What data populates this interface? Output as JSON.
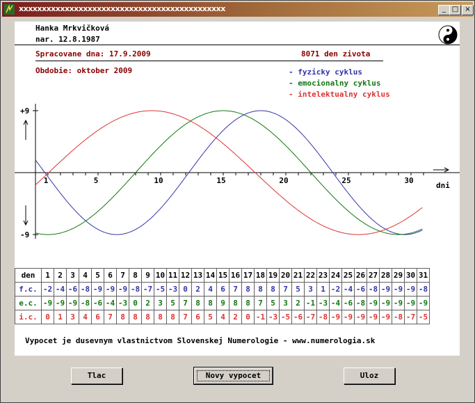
{
  "window": {
    "title": "xxxxxxxxxxxxxxxxxxxxxxxxxxxxxxxxxxxxxxxxxxxxx",
    "controls": {
      "minimize": "_",
      "maximize": "□",
      "close": "×"
    }
  },
  "header": {
    "name": "Hanka Mrkvičková",
    "birth": "nar. 12.8.1987",
    "processed": "Spracovane dna: 17.9.2009",
    "days_alive": "8071 den zivota",
    "period": "Obdobie: oktober 2009"
  },
  "colors": {
    "physical": "#3333aa",
    "emotional": "#117711",
    "intellectual": "#dd3333",
    "header_red": "#880000"
  },
  "chart_data": {
    "type": "line",
    "legend": [
      {
        "label": "- fyzicky cyklus",
        "color": "#3333aa"
      },
      {
        "label": "- emocionalny cyklus",
        "color": "#117711"
      },
      {
        "label": "- intelektualny cyklus",
        "color": "#dd3333"
      }
    ],
    "y_top_label": "+9",
    "y_bottom_label": "-9",
    "x_label": "dni",
    "x_ticks": [
      1,
      5,
      10,
      15,
      20,
      25,
      30
    ],
    "ylim": [
      -9,
      9
    ],
    "xlim": [
      1,
      31
    ],
    "series": [
      {
        "name": "fyzicky cyklus",
        "period": 23,
        "peak_day": 18,
        "color": "#3333aa"
      },
      {
        "name": "emocionalny cyklus",
        "period": 28,
        "peak_day": 15,
        "color": "#117711"
      },
      {
        "name": "intelektualny cyklus",
        "period": 33,
        "peak_day": 9.3,
        "color": "#dd3333"
      }
    ]
  },
  "table": {
    "header_label": "den",
    "days": [
      "1",
      "2",
      "3",
      "4",
      "5",
      "6",
      "7",
      "8",
      "9",
      "10",
      "11",
      "12",
      "13",
      "14",
      "15",
      "16",
      "17",
      "18",
      "19",
      "20",
      "21",
      "22",
      "23",
      "24",
      "25",
      "26",
      "27",
      "28",
      "29",
      "30",
      "31"
    ],
    "rows": [
      {
        "label": "f.c.",
        "color": "#3333aa",
        "values": [
          "-2",
          "-4",
          "-6",
          "-8",
          "-9",
          "-9",
          "-9",
          "-8",
          "-7",
          "-5",
          "-3",
          "0",
          "2",
          "4",
          "6",
          "7",
          "8",
          "8",
          "8",
          "7",
          "5",
          "3",
          "1",
          "-2",
          "-4",
          "-6",
          "-8",
          "-9",
          "-9",
          "-9",
          "-8"
        ]
      },
      {
        "label": "e.c.",
        "color": "#117711",
        "values": [
          "-9",
          "-9",
          "-9",
          "-8",
          "-6",
          "-4",
          "-3",
          "0",
          "2",
          "3",
          "5",
          "7",
          "8",
          "8",
          "9",
          "8",
          "8",
          "7",
          "5",
          "3",
          "2",
          "-1",
          "-3",
          "-4",
          "-6",
          "-8",
          "-9",
          "-9",
          "-9",
          "-9",
          "-9"
        ]
      },
      {
        "label": "i.c.",
        "color": "#dd3333",
        "values": [
          "0",
          "1",
          "3",
          "4",
          "6",
          "7",
          "8",
          "8",
          "8",
          "8",
          "8",
          "7",
          "6",
          "5",
          "4",
          "2",
          "0",
          "-1",
          "-3",
          "-5",
          "-6",
          "-7",
          "-8",
          "-9",
          "-9",
          "-9",
          "-9",
          "-9",
          "-8",
          "-7",
          "-5"
        ]
      }
    ]
  },
  "footer": "Vypocet je dusevnym vlastnictvom Slovenskej Numerologie - www.numerologia.sk",
  "buttons": {
    "print": "Tlac",
    "new": "Novy vypocet",
    "save": "Uloz"
  }
}
